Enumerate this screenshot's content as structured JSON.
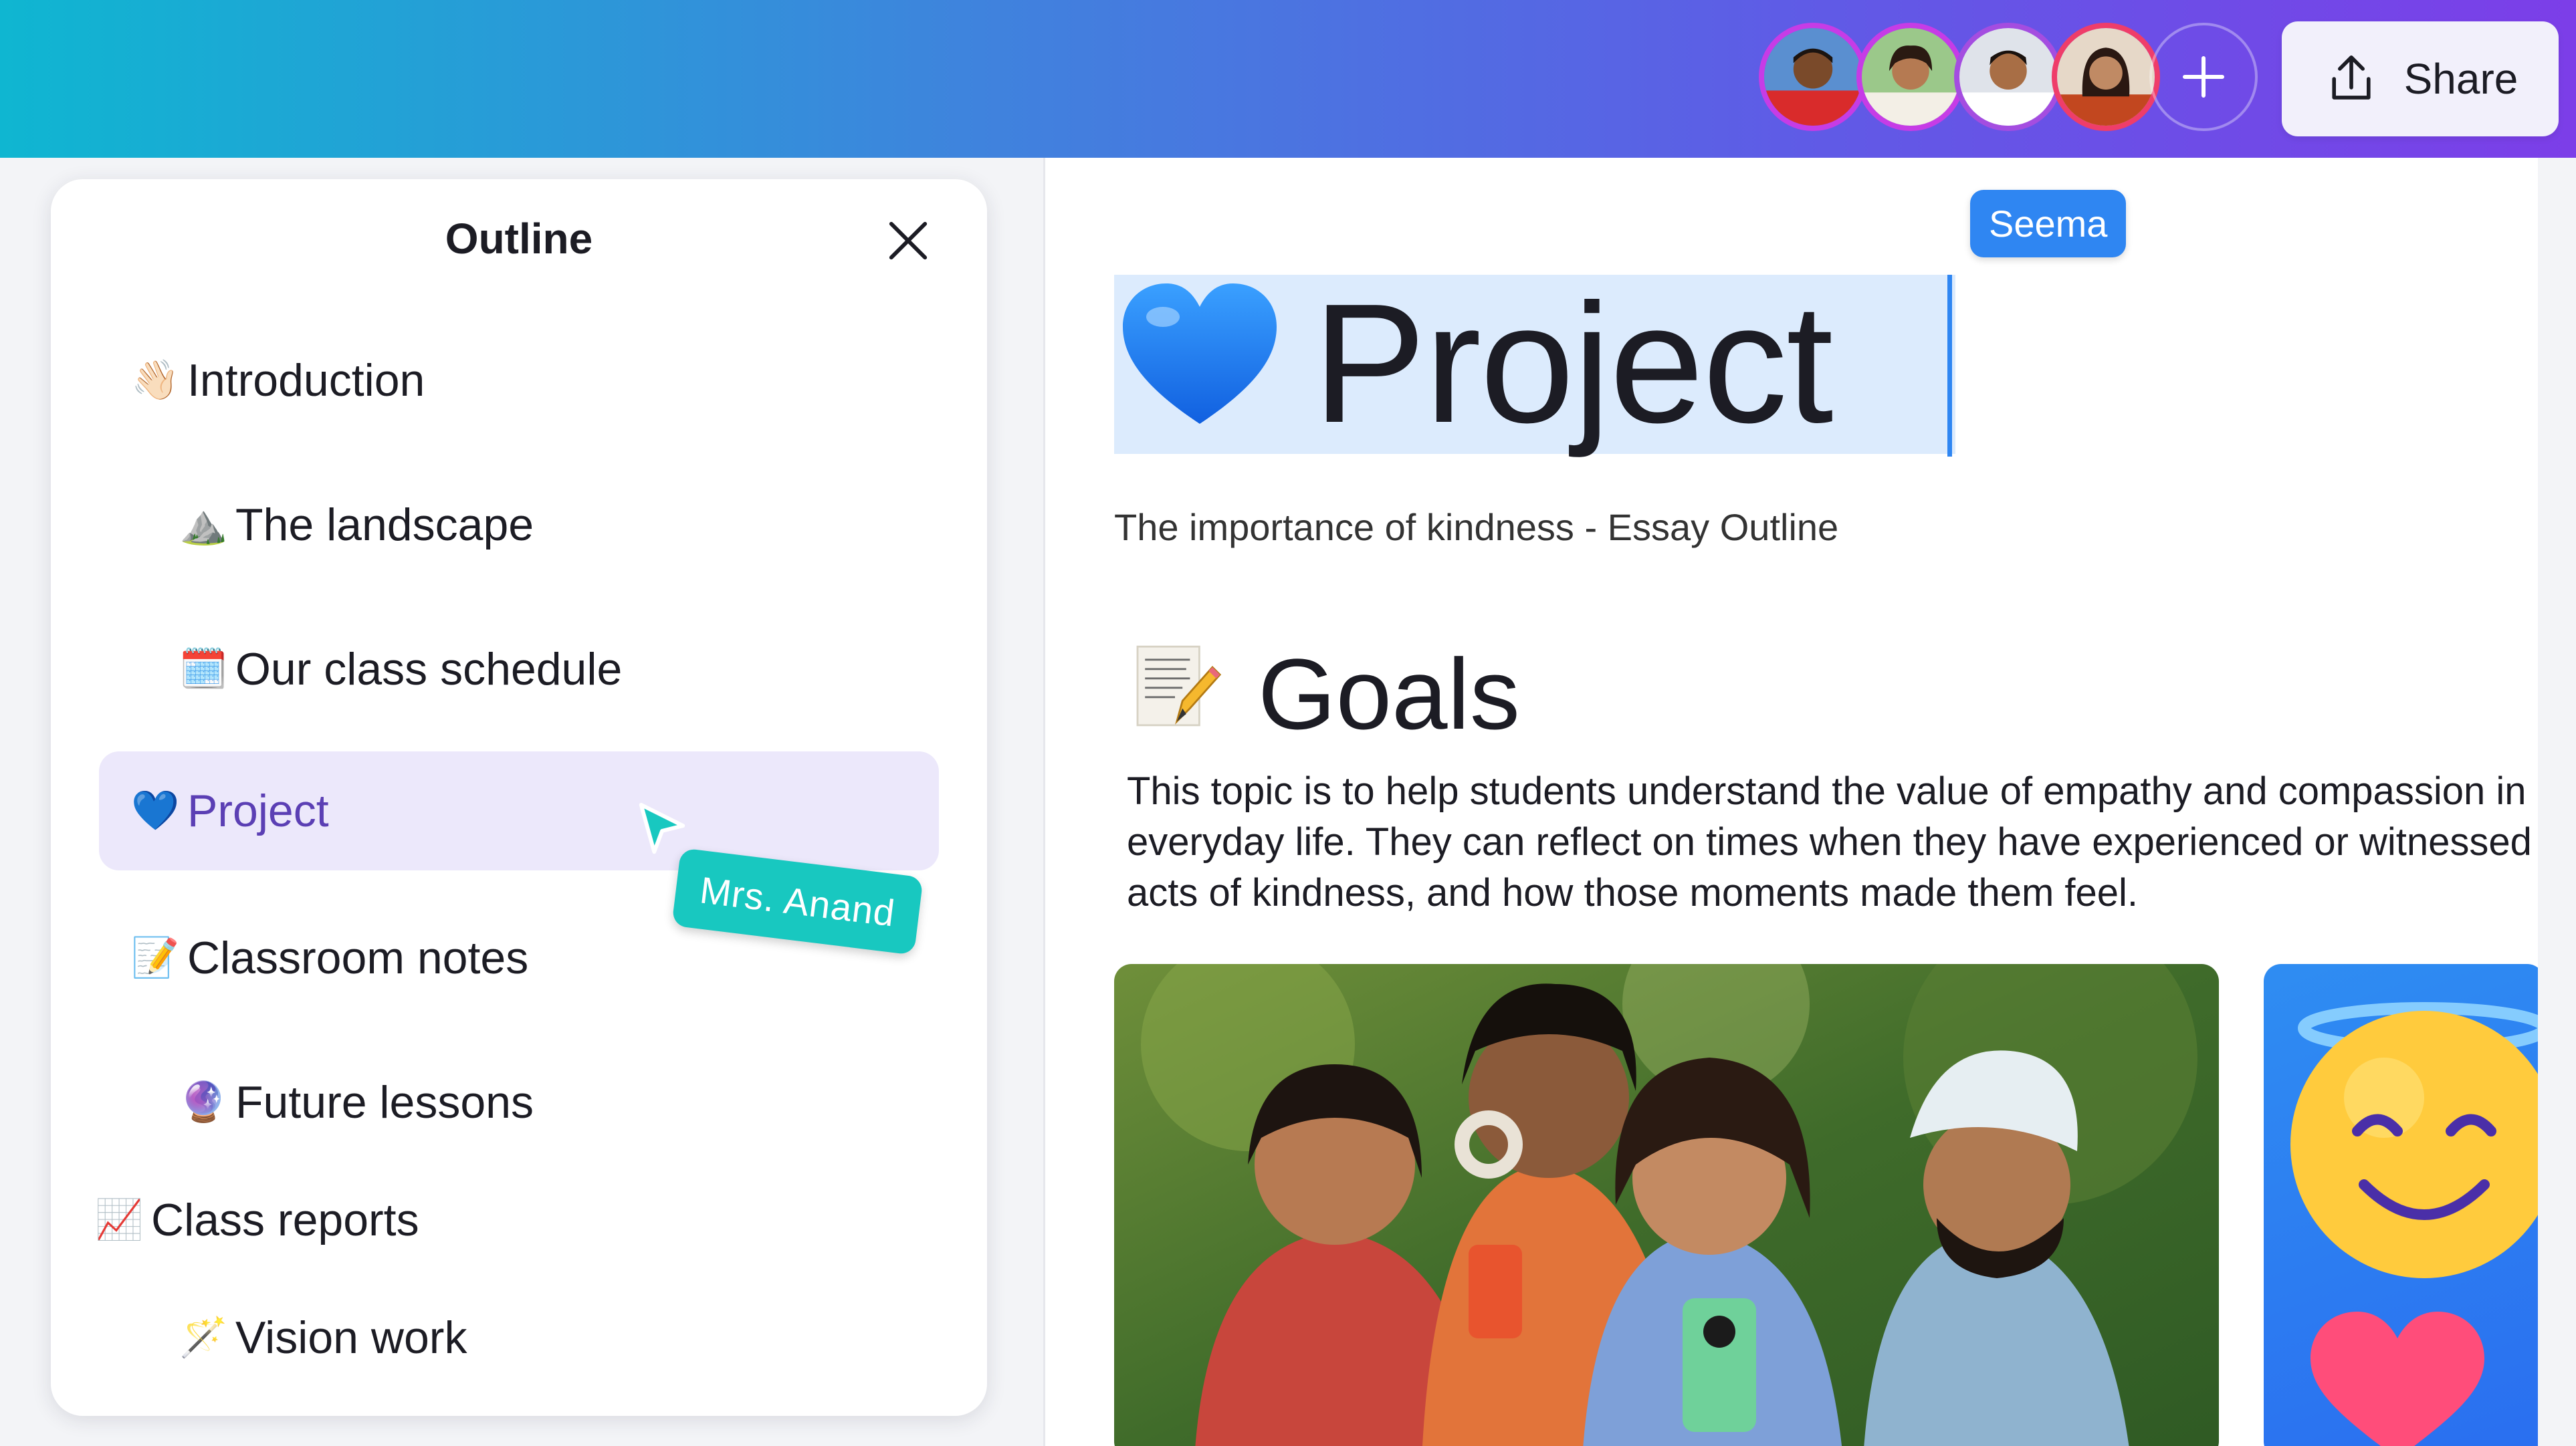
{
  "topbar": {
    "avatars": [
      {
        "name": "collaborator-avatar-1"
      },
      {
        "name": "collaborator-avatar-2"
      },
      {
        "name": "collaborator-avatar-3"
      },
      {
        "name": "collaborator-avatar-4"
      }
    ],
    "add_icon": "plus-icon",
    "share_label": "Share",
    "share_icon": "upload-share-icon"
  },
  "outline": {
    "title": "Outline",
    "close_icon": "close-icon",
    "items": [
      {
        "emoji": "👋🏻",
        "label": "Introduction",
        "level": 1
      },
      {
        "emoji": "⛰️",
        "label": "The landscape",
        "level": 2
      },
      {
        "emoji": "🗓️",
        "label": "Our class schedule",
        "level": 2
      },
      {
        "emoji": "💙",
        "label": "Project",
        "level": 1,
        "active": true
      },
      {
        "emoji": "📝",
        "label": "Classroom notes",
        "level": 1
      },
      {
        "emoji": "🔮",
        "label": "Future lessons",
        "level": 2
      },
      {
        "emoji": "📈",
        "label": "Class reports",
        "level": 0
      },
      {
        "emoji": "🪄",
        "label": "Vision work",
        "level": 2
      }
    ],
    "cursor_tag": "Mrs. Anand"
  },
  "document": {
    "cursor_tag": "Seema",
    "title": "Project",
    "title_emoji": "💙",
    "subtitle": "The importance of kindness - Essay Outline",
    "section_heading": "Goals",
    "section_emoji": "📝",
    "section_body": "This topic is to help students understand the value of empathy and compassion in everyday life. They can reflect on times when they have experienced or witnessed acts of kindness, and how those moments made them feel."
  },
  "colors": {
    "active_item_bg": "#ece8fb",
    "active_item_text": "#5b3fb4",
    "selection_bg": "#dcebfd",
    "seema_tag": "#2f86f2",
    "anand_tag": "#18c8c0"
  }
}
